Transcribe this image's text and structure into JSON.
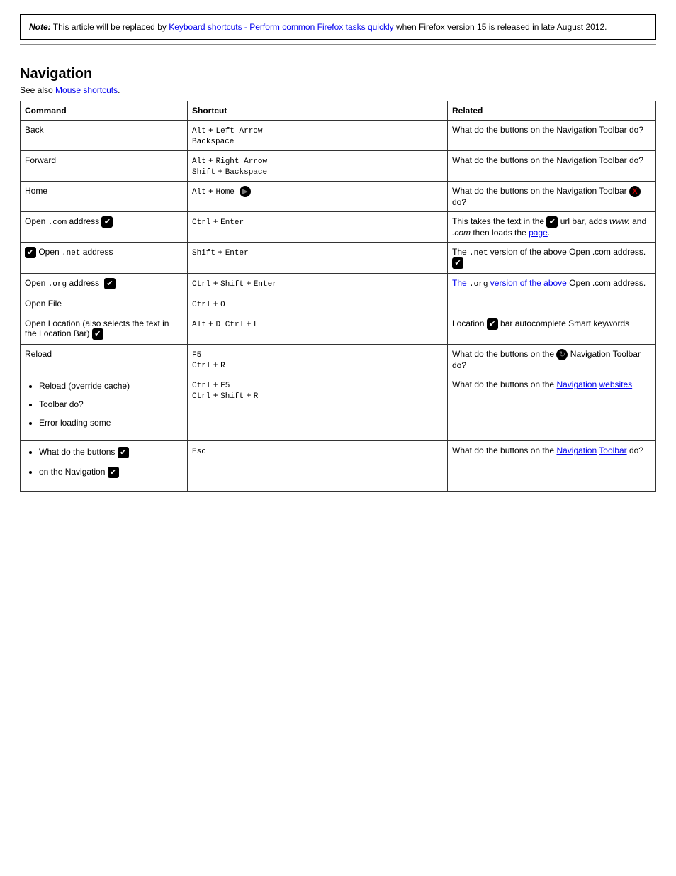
{
  "note": {
    "label": "Note:",
    "text_before": "This article will be replaced by ",
    "link_text": "Keyboard shortcuts - Perform common Firefox tasks quickly",
    "text_after": " when Firefox version 15 is released in late August 2012."
  },
  "section": {
    "title": "Navigation",
    "intro_before": "See also ",
    "intro_link": "Mouse shortcuts",
    "intro_after": "."
  },
  "table": {
    "headers": [
      "Command",
      "Shortcut",
      "Related"
    ],
    "rows": [
      {
        "command": "Back",
        "shortcut_html": "<span class='key'>Alt</span> + <span class='key'>Left Arrow</span><br><span class='key'>Backspace</span>",
        "related_html": "What do the buttons on the Navigation Toolbar do?"
      },
      {
        "command": "Forward",
        "shortcut_html": "<span class='key'>Alt</span> + <span class='key'>Right Arrow</span><br><span class='key'>Shift</span> + <span class='key'>Backspace</span>",
        "related_html": "What do the buttons on the Navigation Toolbar do?"
      },
      {
        "command": "Home",
        "shortcut_html": "<span class='key'>Alt</span> + <span class='key'>Home</span>&nbsp; <span class='icon circle inline-icon' data-name='go-icon' data-interactable='false'>▶</span>",
        "related_html": "What do the buttons on the Navigation Toolbar <span class='icon xcirc inline-icon' data-name='x-icon' data-interactable='false'>X</span> do?"
      },
      {
        "command_html": "Open <span class='key'>.com</span> address <span class='icon chk inline-icon' data-name='check-icon' data-interactable='false'>✔</span>",
        "shortcut_html": "<span class='key'>Ctrl</span> + <span class='key'>Enter</span>",
        "related_html": "This takes the text in the <span class='icon chk inline-icon' data-name='check-icon' data-interactable='false'>✔</span> url bar, adds <i>www.</i> and <i>.com</i> then loads the <a href='#' data-name='page-link' data-interactable='true'>page</a>."
      },
      {
        "command_html": "<span class='icon chk inline-icon' data-name='check-icon' data-interactable='false'>✔</span> Open <span class='key'>.net</span> address",
        "shortcut_html": "<span class='key'>Shift</span> + <span class='key'>Enter</span>",
        "related_html": "The <span class='key'>.net</span> version of the above Open .com address.&nbsp; <span class='icon chk inline-icon' data-name='check-icon' data-interactable='false'>✔</span>"
      },
      {
        "command_html": "Open <span class='key'>.org</span> address&nbsp; <span class='icon chk inline-icon' data-name='check-icon' data-interactable='false'>✔</span>",
        "shortcut_html": "<span class='key'>Ctrl</span> + <span class='key'>Shift</span> + <span class='key'>Enter</span>",
        "related_html": "<a href='#' data-name='the-link' data-interactable='true'>The</a> <span class='key'>.org</span> <a href='#' data-name='version-link' data-interactable='true'>version of the above</a> Open .com address."
      },
      {
        "command_html": "Open File",
        "shortcut_html": "<span class='key'>Ctrl</span> + <span class='key'>O</span>",
        "related_html": ""
      },
      {
        "command_html": "Open Location (also selects the text in the Location Bar) <span class='icon chk inline-icon' data-name='check-icon' data-interactable='false'>✔</span>",
        "shortcut_html": "<span class='key'>Alt</span> + <span class='key'>D</span>&nbsp; <span class='key'>Ctrl</span> + <span class='key'>L</span>",
        "related_html": "Location <span class='icon chk inline-icon' data-name='check-icon' data-interactable='false'>✔</span> bar autocomplete Smart keywords"
      },
      {
        "command_html": "Reload",
        "shortcut_html": "<span class='key'>F5</span><br><span class='key'>Ctrl</span> + <span class='key'>R</span>",
        "related_html": "What do the buttons on the <span class='icon circle inline-icon' data-name='reload-icon' data-interactable='false'>↻</span> Navigation Toolbar do?"
      },
      {
        "command_html": "<ul class='bullets'><li>Reload (override cache)</li><li>Toolbar do?</li><li>Error loading some</li></ul>",
        "shortcut_html": "<span class='key'>Ctrl</span> + <span class='key'>F5</span><br><span class='key'>Ctrl</span> + <span class='key'>Shift</span> + <span class='key'>R</span>",
        "related_html": "What do the buttons on the <a href='#' data-name='navigation-link' data-interactable='true'>Navigation</a> <a href='#' data-name='websites-link' data-interactable='true'>websites</a>"
      },
      {
        "command_html": "<ul class='bullets'><li>What do the buttons <span class='icon chk inline-icon' data-name='check-icon' data-interactable='false'>✔</span></li><li>on the Navigation <span class='icon chk inline-icon' data-name='check-icon' data-interactable='false'>✔</span></li></ul>",
        "shortcut_html": "<span class='key'>Esc</span>",
        "related_html": "What do the buttons on the <a href='#' data-name='navigation-link-2' data-interactable='true'>Navigation</a> <a href='#' data-name='toolbar-link' data-interactable='true'>Toolbar</a> do?"
      }
    ]
  }
}
